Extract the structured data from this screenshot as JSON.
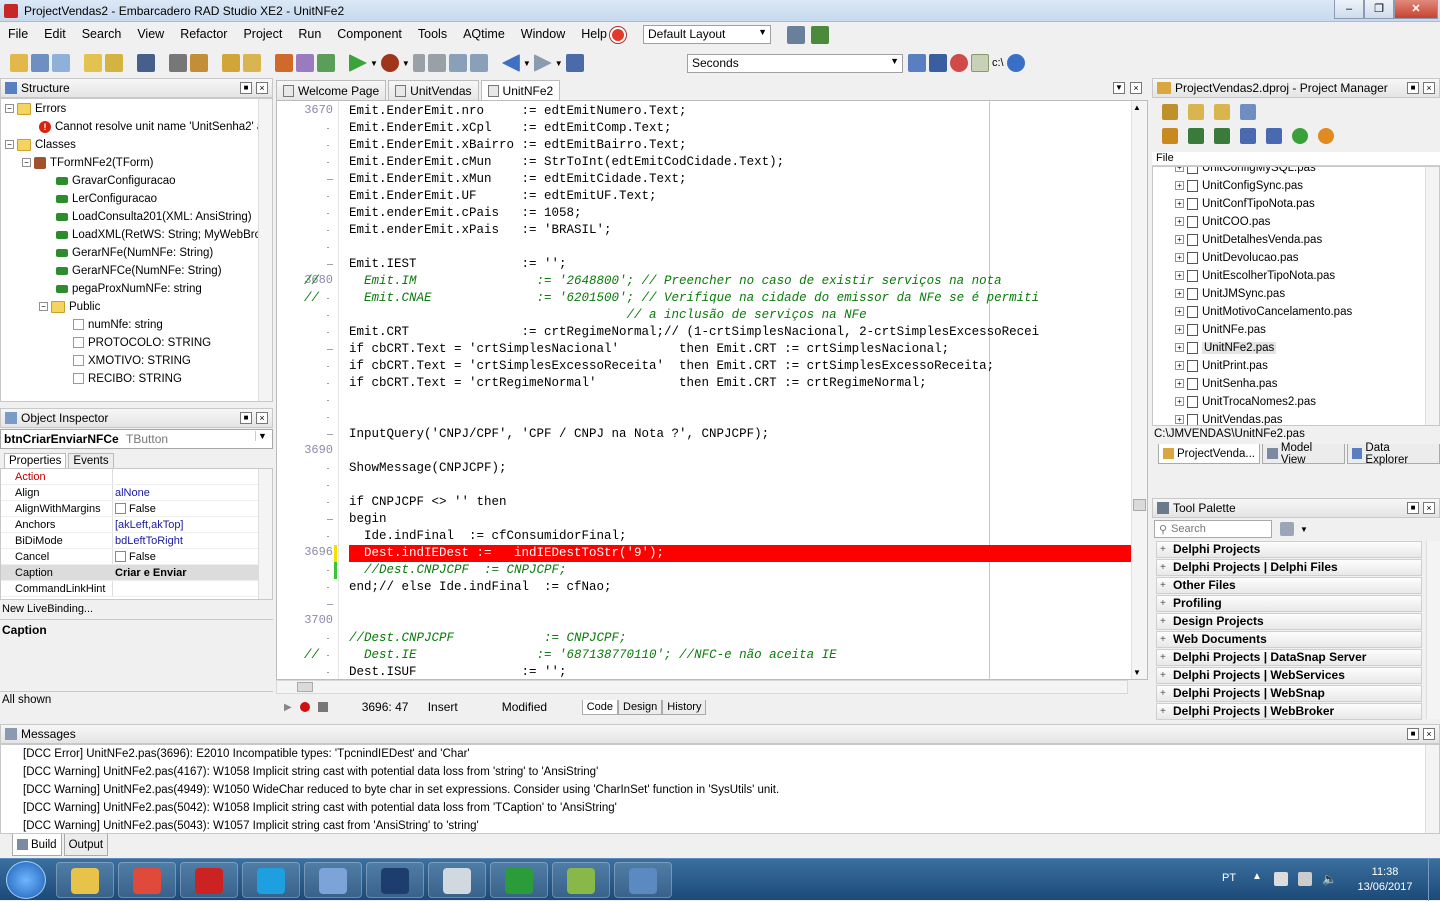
{
  "window": {
    "title": "ProjectVendas2 - Embarcadero RAD Studio XE2 - UnitNFe2"
  },
  "menu": [
    "File",
    "Edit",
    "Search",
    "View",
    "Refactor",
    "Project",
    "Run",
    "Component",
    "Tools",
    "AQtime",
    "Window",
    "Help"
  ],
  "layout_combo": "Default Layout",
  "seconds_combo": "Seconds",
  "structure": {
    "title": "Structure",
    "rows": [
      {
        "label": "Errors",
        "indent": 0,
        "icon": "folder"
      },
      {
        "label": "Cannot resolve unit name 'UnitSenha2' at",
        "indent": 2,
        "icon": "error"
      },
      {
        "label": "Classes",
        "indent": 0,
        "icon": "folder"
      },
      {
        "label": "TFormNFe2(TForm)",
        "indent": 1,
        "icon": "class"
      },
      {
        "label": "GravarConfiguracao",
        "indent": 3,
        "icon": "method"
      },
      {
        "label": "LerConfiguracao",
        "indent": 3,
        "icon": "method"
      },
      {
        "label": "LoadConsulta201(XML: AnsiString)",
        "indent": 3,
        "icon": "method"
      },
      {
        "label": "LoadXML(RetWS: String; MyWebBrow",
        "indent": 3,
        "icon": "method"
      },
      {
        "label": "GerarNFe(NumNFe: String)",
        "indent": 3,
        "icon": "method"
      },
      {
        "label": "GerarNFCe(NumNFe: String)",
        "indent": 3,
        "icon": "method"
      },
      {
        "label": "pegaProxNumNFe: string",
        "indent": 3,
        "icon": "method"
      },
      {
        "label": "Public",
        "indent": 2,
        "icon": "folder"
      },
      {
        "label": "numNfe: string",
        "indent": 4,
        "icon": "prop"
      },
      {
        "label": "PROTOCOLO: STRING",
        "indent": 4,
        "icon": "prop"
      },
      {
        "label": "XMOTIVO: STRING",
        "indent": 4,
        "icon": "prop"
      },
      {
        "label": "RECIBO: STRING",
        "indent": 4,
        "icon": "prop"
      }
    ]
  },
  "object_inspector": {
    "title": "Object Inspector",
    "selected": "btnCriarEnviarNFCe",
    "selected_type": "TButton",
    "tabs": [
      "Properties",
      "Events"
    ],
    "rows": [
      {
        "name": "Action",
        "value": "",
        "red": true
      },
      {
        "name": "Align",
        "value": "alNone",
        "blue": true
      },
      {
        "name": "AlignWithMargins",
        "value": "False",
        "check": true
      },
      {
        "name": "Anchors",
        "value": "[akLeft,akTop]",
        "blue": true,
        "plus": true
      },
      {
        "name": "BiDiMode",
        "value": "bdLeftToRight",
        "blue": true
      },
      {
        "name": "Cancel",
        "value": "False",
        "check": true
      },
      {
        "name": "Caption",
        "value": "Criar e Enviar",
        "bold": true,
        "current": true
      },
      {
        "name": "CommandLinkHint",
        "value": ""
      }
    ],
    "livebinding": "New LiveBinding...",
    "desc_title": "Caption",
    "footer": "All shown"
  },
  "editor": {
    "tabs": [
      "Welcome Page",
      "UnitVendas",
      "UnitNFe2"
    ],
    "active_tab": "UnitNFe2",
    "line_numbers": [
      {
        "n": "3670",
        "row": 0
      },
      {
        "n": "3680",
        "row": 10
      },
      {
        "n": "3690",
        "row": 20
      },
      {
        "n": "3696",
        "row": 26
      },
      {
        "n": "3700",
        "row": 30
      }
    ],
    "lines": [
      {
        "t": "Emit.EnderEmit.nro     := edtEmitNumero.Text;"
      },
      {
        "t": "Emit.EnderEmit.xCpl    := edtEmitComp.Text;"
      },
      {
        "t": "Emit.EnderEmit.xBairro := edtEmitBairro.Text;"
      },
      {
        "t": "Emit.EnderEmit.cMun    := StrToInt(edtEmitCodCidade.Text);"
      },
      {
        "t": "Emit.EnderEmit.xMun    := edtEmitCidade.Text;"
      },
      {
        "t": "Emit.EnderEmit.UF      := edtEmitUF.Text;"
      },
      {
        "t": "Emit.enderEmit.cPais   := 1058;"
      },
      {
        "t": "Emit.enderEmit.xPais   := 'BRASIL';"
      },
      {
        "t": ""
      },
      {
        "t": "Emit.IEST              := '';"
      },
      {
        "t": "//      Emit.IM                := '2648800'; // Preencher no caso de existir serviços na nota",
        "c": "comment",
        "ind": -6
      },
      {
        "t": "//      Emit.CNAE              := '6201500'; // Verifique na cidade do emissor da NFe se é permiti",
        "c": "comment",
        "ind": -6
      },
      {
        "t": "                                           // a inclusão de serviços na NFe",
        "c": "comment",
        "ind": -6
      },
      {
        "t": "Emit.CRT               := crtRegimeNormal;// (1-crtSimplesNacional, 2-crtSimplesExcessoRecei"
      },
      {
        "t": "if cbCRT.Text = 'crtSimplesNacional'        then Emit.CRT := crtSimplesNacional;"
      },
      {
        "t": "if cbCRT.Text = 'crtSimplesExcessoReceita'  then Emit.CRT := crtSimplesExcessoReceita;"
      },
      {
        "t": "if cbCRT.Text = 'crtRegimeNormal'           then Emit.CRT := crtRegimeNormal;"
      },
      {
        "t": ""
      },
      {
        "t": ""
      },
      {
        "t": "InputQuery('CNPJ/CPF', 'CPF / CNPJ na Nota ?', CNPJCPF);"
      },
      {
        "t": ""
      },
      {
        "t": "ShowMessage(CNPJCPF);"
      },
      {
        "t": ""
      },
      {
        "t": "if CNPJCPF <> '' then"
      },
      {
        "t": "begin"
      },
      {
        "t": "  Ide.indFinal  := cfConsumidorFinal;"
      },
      {
        "t": "  Dest.indIEDest :=   indIEDestToStr('9');",
        "c": "err"
      },
      {
        "t": "  //Dest.CNPJCPF  := CNPJCPF;",
        "c": "comment"
      },
      {
        "t": "end;// else Ide.indFinal  := cfNao;"
      },
      {
        "t": ""
      },
      {
        "t": ""
      },
      {
        "t": "//Dest.CNPJCPF            := CNPJCPF;",
        "c": "comment"
      },
      {
        "t": "//      Dest.IE                := '687138770110'; //NFC-e não aceita IE",
        "c": "comment",
        "ind": -6
      },
      {
        "t": "Dest.ISUF              := '';"
      }
    ],
    "status": {
      "position": "3696: 47",
      "mode": "Insert",
      "modified": "Modified"
    },
    "view_tabs": [
      "Code",
      "Design",
      "History"
    ]
  },
  "project_manager": {
    "title": "ProjectVendas2.dproj - Project Manager",
    "column": "File",
    "files": [
      "UnitConfigMySQL.pas",
      "UnitConfigSync.pas",
      "UnitConfTipoNota.pas",
      "UnitCOO.pas",
      "UnitDetalhesVenda.pas",
      "UnitDevolucao.pas",
      "UnitEscolherTipoNota.pas",
      "UnitJMSync.pas",
      "UnitMotivoCancelamento.pas",
      "UnitNFe.pas",
      "UnitNFe2.pas",
      "UnitPrint.pas",
      "UnitSenha.pas",
      "UnitTrocaNomes2.pas",
      "UnitVendas.pas"
    ],
    "path": "C:\\JMVENDAS\\UnitNFe2.pas",
    "bottom_tabs": [
      "ProjectVenda...",
      "Model View",
      "Data Explorer"
    ]
  },
  "tool_palette": {
    "title": "Tool Palette",
    "search_placeholder": "Search",
    "categories": [
      "Delphi Projects",
      "Delphi Projects | Delphi Files",
      "Other Files",
      "Profiling",
      "Design Projects",
      "Web Documents",
      "Delphi Projects | DataSnap Server",
      "Delphi Projects | WebServices",
      "Delphi Projects | WebSnap",
      "Delphi Projects | WebBroker"
    ]
  },
  "messages": {
    "title": "Messages",
    "lines": [
      "[DCC Error] UnitNFe2.pas(3696): E2010 Incompatible types: 'TpcnindIEDest' and 'Char'",
      "[DCC Warning] UnitNFe2.pas(4167): W1058 Implicit string cast with potential data loss from 'string' to 'AnsiString'",
      "[DCC Warning] UnitNFe2.pas(4949): W1050 WideChar reduced to byte char in set expressions.  Consider using 'CharInSet' function in 'SysUtils' unit.",
      "[DCC Warning] UnitNFe2.pas(5042): W1058 Implicit string cast with potential data loss from 'TCaption' to 'AnsiString'",
      "[DCC Warning] UnitNFe2.pas(5043): W1057 Implicit string cast from 'AnsiString' to 'string'"
    ],
    "tabs": [
      "Build",
      "Output"
    ]
  },
  "taskbar": {
    "lang": "PT",
    "time": "11:38",
    "date": "13/06/2017",
    "apps": [
      {
        "icon": "explorer-icon",
        "color": "#e8c34a"
      },
      {
        "icon": "chrome-icon",
        "color": "#e04a3a"
      },
      {
        "icon": "delphi-app-icon",
        "color": "#cc2222"
      },
      {
        "icon": "skype-icon",
        "color": "#1ea0e0"
      },
      {
        "icon": "network-icon",
        "color": "#7ca4d8"
      },
      {
        "icon": "photoshop-icon",
        "color": "#1c3d6e"
      },
      {
        "icon": "calculator-icon",
        "color": "#d0d8e0"
      },
      {
        "icon": "hs-icon",
        "color": "#2a9d3a"
      },
      {
        "icon": "notepad-icon",
        "color": "#88b848"
      },
      {
        "icon": "remote-icon",
        "color": "#5a8ac0"
      }
    ]
  }
}
